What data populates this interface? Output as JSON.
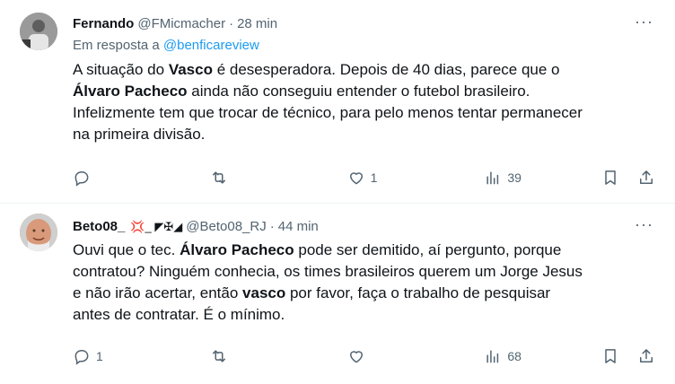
{
  "tweets": [
    {
      "name": "Fernando",
      "handle": "@FMicmacher",
      "time": "28 min",
      "reply_prefix": "Em resposta a ",
      "reply_handle": "@benficareview",
      "text_parts": [
        "A situação do ",
        "Vasco",
        " é desesperadora. Depois de 40 dias, parece que o\n",
        "Álvaro Pacheco",
        " ainda não conseguiu entender o futebol brasileiro.\nInfelizmente tem que trocar de técnico, para pelo menos tentar permanecer\nna primeira divisão."
      ],
      "replies": "",
      "retweets": "",
      "likes": "1",
      "views": "39"
    },
    {
      "name": "Beto08_",
      "badges": "💢_ ◤✠◢",
      "handle": "@Beto08_RJ",
      "time": "44 min",
      "text_parts": [
        "Ouvi que o tec. ",
        "Álvaro Pacheco",
        " pode ser demitido, aí pergunto, porque\ncontratou? Ninguém conhecia, os times brasileiros querem um Jorge Jesus\ne não irão acertar, então ",
        "vasco",
        " por favor, faça o trabalho de pesquisar\nantes de contratar. É o mínimo."
      ],
      "replies": "1",
      "retweets": "",
      "likes": "",
      "views": "68"
    }
  ],
  "ui": {
    "dot": "·",
    "more": "···"
  }
}
